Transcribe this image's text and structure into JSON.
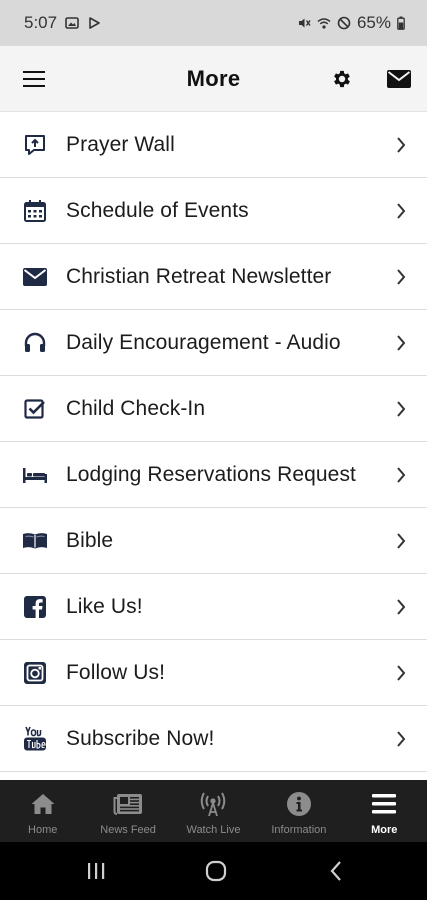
{
  "status_bar": {
    "time": "5:07",
    "battery": "65%"
  },
  "header": {
    "title": "More",
    "menu_icon": "hamburger-icon",
    "settings_icon": "gear-icon",
    "mail_icon": "envelope-icon"
  },
  "menu": {
    "items": [
      {
        "label": "Prayer Wall",
        "icon": "speech-bubble-icon"
      },
      {
        "label": "Schedule of Events",
        "icon": "calendar-icon"
      },
      {
        "label": "Christian Retreat Newsletter",
        "icon": "envelope-icon"
      },
      {
        "label": "Daily Encouragement - Audio",
        "icon": "headphones-icon"
      },
      {
        "label": "Child Check-In",
        "icon": "checkbox-icon"
      },
      {
        "label": "Lodging Reservations Request",
        "icon": "bed-icon"
      },
      {
        "label": "Bible",
        "icon": "book-icon"
      },
      {
        "label": "Like Us!",
        "icon": "facebook-icon"
      },
      {
        "label": "Follow Us!",
        "icon": "instagram-icon"
      },
      {
        "label": "Subscribe Now!",
        "icon": "youtube-icon"
      }
    ]
  },
  "tabs": [
    {
      "label": "Home",
      "icon": "home-icon",
      "active": false
    },
    {
      "label": "News Feed",
      "icon": "newspaper-icon",
      "active": false
    },
    {
      "label": "Watch Live",
      "icon": "broadcast-icon",
      "active": false
    },
    {
      "label": "Information",
      "icon": "info-icon",
      "active": false
    },
    {
      "label": "More",
      "icon": "menu-icon",
      "active": true
    }
  ],
  "colors": {
    "icon_navy": "#1f2a44",
    "status_bar_bg": "#d9d9d9",
    "header_bg": "#f4f4f4",
    "tab_bar_bg": "#1f1f1f",
    "tab_inactive": "#8c8c8c",
    "tab_active": "#ffffff"
  }
}
